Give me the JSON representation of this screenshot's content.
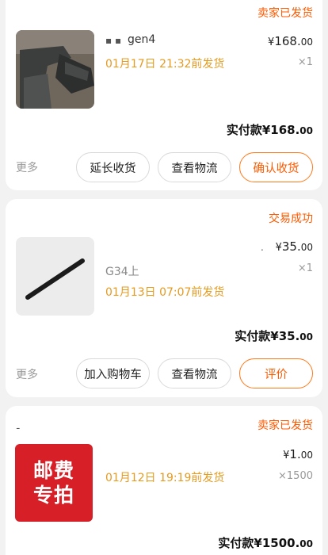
{
  "orders": [
    {
      "status": "卖家已发货",
      "title": "gen4",
      "ship_time": "01月17日 21:32前发货",
      "price_currency": "¥",
      "price_int": "168.",
      "price_dec": "00",
      "quantity": "×1",
      "paid_label": "实付款",
      "paid_currency": "¥",
      "paid_int": "168.",
      "paid_dec": "00",
      "more": "更多",
      "buttons": [
        "延长收货",
        "查看物流",
        "确认收货"
      ]
    },
    {
      "status": "交易成功",
      "title": "G34上",
      "ship_time": "01月13日 07:07前发货",
      "price_currency": "¥",
      "price_int": "35.",
      "price_dec": "00",
      "quantity": "×1",
      "paid_label": "实付款",
      "paid_currency": "¥",
      "paid_int": "35.",
      "paid_dec": "00",
      "more": "更多",
      "buttons": [
        "加入购物车",
        "查看物流",
        "评价"
      ]
    },
    {
      "status": "卖家已发货",
      "badge_line1": "邮费",
      "badge_line2": "专拍",
      "ship_time": "01月12日 19:19前发货",
      "price_currency": "¥",
      "price_int": "1.",
      "price_dec": "00",
      "quantity": "×1500",
      "paid_label": "实付款",
      "paid_currency": "¥",
      "paid_int": "1500.",
      "paid_dec": "00"
    }
  ],
  "colors": {
    "accent": "#ff5a00",
    "ship_time": "#e69a1e",
    "badge_red": "#d61f26"
  }
}
